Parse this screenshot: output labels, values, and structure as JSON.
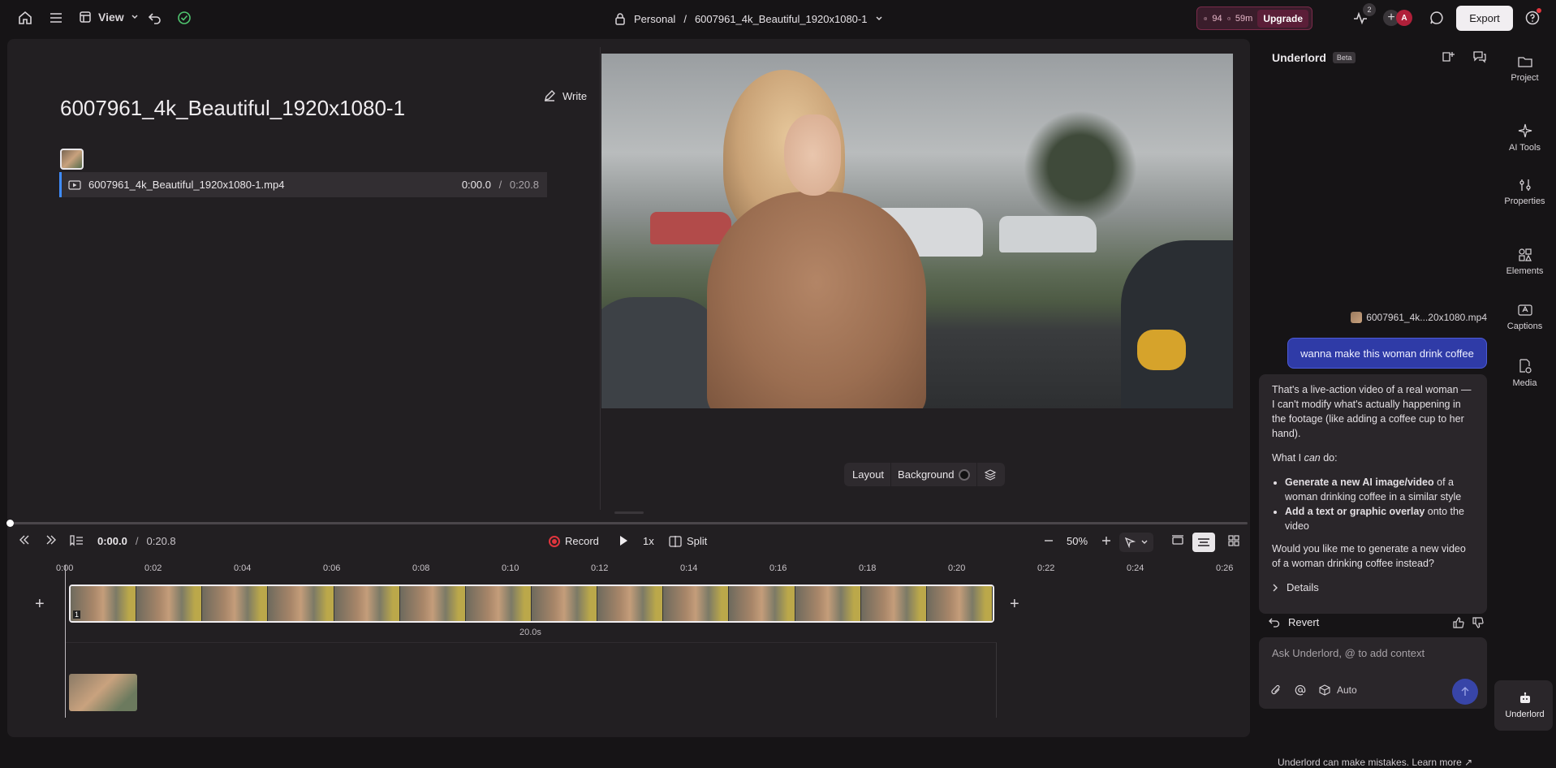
{
  "topbar": {
    "view_label": "View",
    "workspace": "Personal",
    "separator": "/",
    "project_name": "6007961_4k_Beautiful_1920x1080-1",
    "credits_a": "94",
    "credits_b": "59m",
    "upgrade_label": "Upgrade",
    "notif_count": "2",
    "avatar_letter": "A",
    "export_label": "Export"
  },
  "script": {
    "write_label": "Write",
    "title": "6007961_4k_Beautiful_1920x1080-1",
    "clip_name": "6007961_4k_Beautiful_1920x1080-1.mp4",
    "clip_time_current": "0:00.0",
    "clip_time_sep": "/",
    "clip_time_total": "0:20.8"
  },
  "preview_bar": {
    "layout_label": "Layout",
    "background_label": "Background"
  },
  "controls": {
    "time_current": "0:00.0",
    "time_sep": "/",
    "time_total": "0:20.8",
    "record_label": "Record",
    "speed_label": "1x",
    "split_label": "Split",
    "zoom_label": "50%"
  },
  "ruler": [
    "0:00",
    "0:02",
    "0:04",
    "0:06",
    "0:08",
    "0:10",
    "0:12",
    "0:14",
    "0:16",
    "0:18",
    "0:20",
    "0:22",
    "0:24",
    "0:26"
  ],
  "track": {
    "duration_label": "20.0s",
    "clip_index": "1"
  },
  "chat": {
    "title": "Underlord",
    "badge": "Beta",
    "attachment": "6007961_4k...20x1080.mp4",
    "user_message": "wanna make this woman drink coffee",
    "bot_p1": "That's a live-action video of a real woman — I can't modify what's actually happening in the footage (like adding a coffee cup to her hand).",
    "bot_p2_a": "What I ",
    "bot_p2_em": "can",
    "bot_p2_b": " do:",
    "bullet1_bold": "Generate a new AI image/video",
    "bullet1_rest": " of a woman drinking coffee in a similar style",
    "bullet2_bold": "Add a text or graphic overlay",
    "bullet2_rest": " onto the video",
    "bot_p3": "Would you like me to generate a new video of a woman drinking coffee instead?",
    "details_label": "Details",
    "revert_label": "Revert",
    "input_placeholder": "Ask Underlord, @ to add context",
    "auto_label": "Auto",
    "disclaimer": "Underlord can make mistakes. Learn more ↗"
  },
  "rail": {
    "project": "Project",
    "ai_tools": "AI Tools",
    "properties": "Properties",
    "elements": "Elements",
    "captions": "Captions",
    "media": "Media",
    "underlord": "Underlord"
  },
  "colors": {
    "accent_blue": "#2f3ba7",
    "record_red": "#e0353d",
    "upgrade_bg": "#5b1e38"
  }
}
